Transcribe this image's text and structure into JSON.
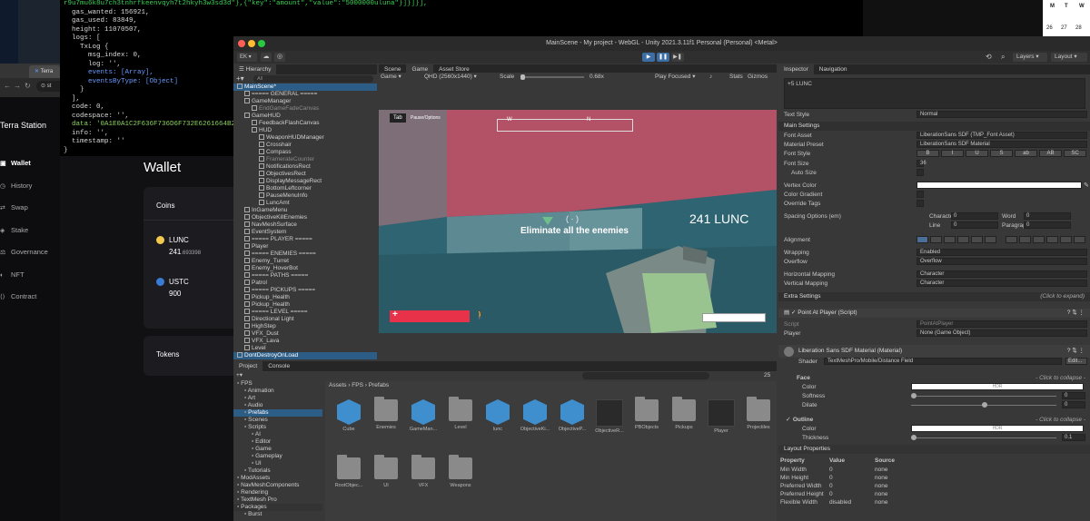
{
  "terminal": {
    "lines": [
      "r9u7mu6k8u7ch3tnhrfkeenvqyh7t2hkyh3w3sd3d\"},{\"key\":\"amount\",\"value\":\"5000000uluna\"}]}]}],",
      "  gas_wanted: 156921,",
      "  gas_used: 83849,",
      "  height: 11070507,",
      "  logs: [",
      "    TxLog {",
      "      msg_index: 0,",
      "      log: '',",
      "      events: [Array],",
      "      eventsByType: [Object]",
      "    }",
      "  ],",
      "  code: 0,",
      "  codespace: '',",
      "  data: '0A1E0A1C2F636F736D6F732E6261664B2E7631",
      "  info: '',",
      "  timestamp: ''",
      "}"
    ]
  },
  "browser": {
    "tab_label": "Terra",
    "address_fragment": "st"
  },
  "wallet": {
    "brand": "Terra Station",
    "nav": [
      "Wallet",
      "History",
      "Swap",
      "Stake",
      "Governance",
      "NFT",
      "Contract"
    ],
    "title": "Wallet",
    "coins_label": "Coins",
    "coins": [
      {
        "symbol": "LUNC",
        "amount_main": "241",
        "amount_dec": ".693398"
      },
      {
        "symbol": "USTC",
        "amount_main": "900",
        "amount_dec": ""
      }
    ],
    "tokens_label": "Tokens"
  },
  "calendar": {
    "days": [
      "M",
      "T",
      "W"
    ],
    "rows": [
      [
        "",
        "",
        ""
      ],
      [
        "26",
        "27",
        "28"
      ],
      [
        "",
        "",
        ""
      ]
    ]
  },
  "unity": {
    "title": "MainScene - My project - WebGL - Unity 2021.3.11f1 Personal (Personal) <Metal>",
    "account": "EK",
    "layers_label": "Layers",
    "layout_label": "Layout",
    "hierarchy": {
      "tab": "Hierarchy",
      "search_placeholder": "All",
      "items": [
        {
          "label": "MainScene*",
          "depth": 0,
          "sel": true
        },
        {
          "label": "===== GENERAL =====",
          "depth": 1
        },
        {
          "label": "GameManager",
          "depth": 1
        },
        {
          "label": "EndGameFadeCanvas",
          "depth": 2,
          "gray": true
        },
        {
          "label": "GameHUD",
          "depth": 1
        },
        {
          "label": "FeedbackFlashCanvas",
          "depth": 2
        },
        {
          "label": "HUD",
          "depth": 2
        },
        {
          "label": "WeaponHUDManager",
          "depth": 3
        },
        {
          "label": "Crosshair",
          "depth": 3
        },
        {
          "label": "Compass",
          "depth": 3
        },
        {
          "label": "FramerateCounter",
          "depth": 3,
          "gray": true
        },
        {
          "label": "NotificationsRect",
          "depth": 3
        },
        {
          "label": "ObjectivesRect",
          "depth": 3
        },
        {
          "label": "DisplayMessageRect",
          "depth": 3
        },
        {
          "label": "BottomLeftcorner",
          "depth": 3
        },
        {
          "label": "PauseMenuInfo",
          "depth": 3
        },
        {
          "label": "LuncAmt",
          "depth": 3
        },
        {
          "label": "InGameMenu",
          "depth": 1
        },
        {
          "label": "ObjectiveKillEnemies",
          "depth": 1
        },
        {
          "label": "NavMeshSurface",
          "depth": 1
        },
        {
          "label": "EventSystem",
          "depth": 1
        },
        {
          "label": "===== PLAYER =====",
          "depth": 1
        },
        {
          "label": "Player",
          "depth": 1
        },
        {
          "label": "===== ENEMIES =====",
          "depth": 1
        },
        {
          "label": "Enemy_Turret",
          "depth": 1
        },
        {
          "label": "Enemy_HoverBot",
          "depth": 1
        },
        {
          "label": "===== PATHS =====",
          "depth": 1
        },
        {
          "label": "Patrol",
          "depth": 1
        },
        {
          "label": "===== PICKUPS =====",
          "depth": 1
        },
        {
          "label": "Pickup_Health",
          "depth": 1
        },
        {
          "label": "Pickup_Health",
          "depth": 1
        },
        {
          "label": "===== LEVEL =====",
          "depth": 1
        },
        {
          "label": "Directional Light",
          "depth": 1
        },
        {
          "label": "HighStep",
          "depth": 1
        },
        {
          "label": "VFX_Dust",
          "depth": 1
        },
        {
          "label": "VFX_Lava",
          "depth": 1
        },
        {
          "label": "Level",
          "depth": 1
        },
        {
          "label": "DontDestroyOnLoad",
          "depth": 0,
          "sel": true
        }
      ]
    },
    "scene_tabs": [
      "Scene",
      "Game",
      "Asset Store"
    ],
    "game_bar": {
      "display": "Game",
      "resolution": "QHD (2560x1440)",
      "scale_label": "Scale",
      "scale_value": "0.68x",
      "play_focused": "Play Focused",
      "stats": "Stats",
      "gizmos": "Gizmos"
    },
    "game": {
      "tab_key": "Tab",
      "tab_hint": "Pause/Options",
      "message": "Eliminate all the enemies",
      "lunc_amount": "241 LUNC",
      "compass": [
        "W",
        "N"
      ]
    },
    "project": {
      "tabs": [
        "Project",
        "Console"
      ],
      "breadcrumb": [
        "Assets",
        "FPS",
        "Prefabs"
      ],
      "count": "25",
      "tree": [
        {
          "label": "FPS",
          "depth": 0
        },
        {
          "label": "Animation",
          "depth": 1
        },
        {
          "label": "Art",
          "depth": 1
        },
        {
          "label": "Audio",
          "depth": 1
        },
        {
          "label": "Prefabs",
          "depth": 1,
          "sel": true
        },
        {
          "label": "Scenes",
          "depth": 1
        },
        {
          "label": "Scripts",
          "depth": 1
        },
        {
          "label": "AI",
          "depth": 2
        },
        {
          "label": "Editor",
          "depth": 2
        },
        {
          "label": "Game",
          "depth": 2
        },
        {
          "label": "Gameplay",
          "depth": 2
        },
        {
          "label": "UI",
          "depth": 2
        },
        {
          "label": "Tutorials",
          "depth": 1
        },
        {
          "label": "ModAssets",
          "depth": 0
        },
        {
          "label": "NavMeshComponents",
          "depth": 0
        },
        {
          "label": "Rendering",
          "depth": 0
        },
        {
          "label": "TextMesh Pro",
          "depth": 0
        },
        {
          "label": "Packages",
          "depth": 0,
          "hdr": true
        },
        {
          "label": "Burst",
          "depth": 1
        }
      ],
      "assets": [
        {
          "label": "Cube",
          "kind": "prefab"
        },
        {
          "label": "Enemies",
          "kind": "folder"
        },
        {
          "label": "GameMan...",
          "kind": "prefab"
        },
        {
          "label": "Level",
          "kind": "folder"
        },
        {
          "label": "lunc",
          "kind": "prefab"
        },
        {
          "label": "ObjectiveKi...",
          "kind": "prefab"
        },
        {
          "label": "ObjectiveP...",
          "kind": "prefab"
        },
        {
          "label": "ObjectiveR...",
          "kind": "dark"
        },
        {
          "label": "PBObjects",
          "kind": "folder"
        },
        {
          "label": "Pickups",
          "kind": "folder"
        },
        {
          "label": "Player",
          "kind": "dark"
        },
        {
          "label": "Projectiles",
          "kind": "folder"
        },
        {
          "label": "RootObjec...",
          "kind": "folder"
        },
        {
          "label": "UI",
          "kind": "folder"
        },
        {
          "label": "VFX",
          "kind": "folder"
        },
        {
          "label": "Weapons",
          "kind": "folder"
        }
      ]
    },
    "inspector": {
      "tabs": [
        "Inspector",
        "Navigation"
      ],
      "text_value": "+5 LUNC",
      "text_style_label": "Text Style",
      "text_style": "Normal",
      "main_settings": "Main Settings",
      "font_asset_label": "Font Asset",
      "font_asset": "LiberationSans SDF (TMP_Font Asset)",
      "material_preset_label": "Material Preset",
      "material_preset": "LiberationSans SDF Material",
      "font_style_label": "Font Style",
      "font_style_buttons": [
        "B",
        "I",
        "U",
        "S",
        "ab",
        "AB",
        "SC"
      ],
      "font_size_label": "Font Size",
      "font_size": "36",
      "auto_size_label": "Auto Size",
      "vertex_color_label": "Vertex Color",
      "color_gradient_label": "Color Gradient",
      "override_tags_label": "Override Tags",
      "spacing_label": "Spacing Options (em)",
      "character_label": "Character",
      "character_value": "0",
      "word_label": "Word",
      "word_value": "0",
      "line_label": "Line",
      "line_value": "0",
      "paragraph_label": "Paragraph",
      "paragraph_value": "0",
      "alignment_label": "Alignment",
      "wrapping_label": "Wrapping",
      "wrapping": "Enabled",
      "overflow_label": "Overflow",
      "overflow": "Overflow",
      "h_mapping_label": "Horizontal Mapping",
      "h_mapping": "Character",
      "v_mapping_label": "Vertical Mapping",
      "v_mapping": "Character",
      "extra_settings": "Extra Settings",
      "click_expand": "(Click to expand)",
      "component_title": "Point At Player (Script)",
      "script_label": "Script",
      "script_value": "PointAtPlayer",
      "player_label": "Player",
      "player_value": "None (Game Object)",
      "material_title": "Liberation Sans SDF Material (Material)",
      "shader_label": "Shader",
      "shader_value": "TextMeshPro/Mobile/Distance Field",
      "edit_label": "Edit...",
      "face_label": "Face",
      "click_collapse": "- Click to collapse -",
      "face_color_label": "Color",
      "hdr": "HDR",
      "softness_label": "Softness",
      "softness_value": "0",
      "dilate_label": "Dilate",
      "dilate_value": "0",
      "outline_label": "Outline",
      "outline_color_label": "Color",
      "thickness_label": "Thickness",
      "thickness_value": "0.1",
      "layout_props": "Layout Properties",
      "lp_headers": [
        "Property",
        "Value",
        "Source"
      ],
      "lp_rows": [
        [
          "Min Width",
          "0",
          "none"
        ],
        [
          "Min Height",
          "0",
          "none"
        ],
        [
          "Preferred Width",
          "0",
          "none"
        ],
        [
          "Preferred Height",
          "0",
          "none"
        ],
        [
          "Flexible Width",
          "disabled",
          "none"
        ]
      ]
    }
  }
}
